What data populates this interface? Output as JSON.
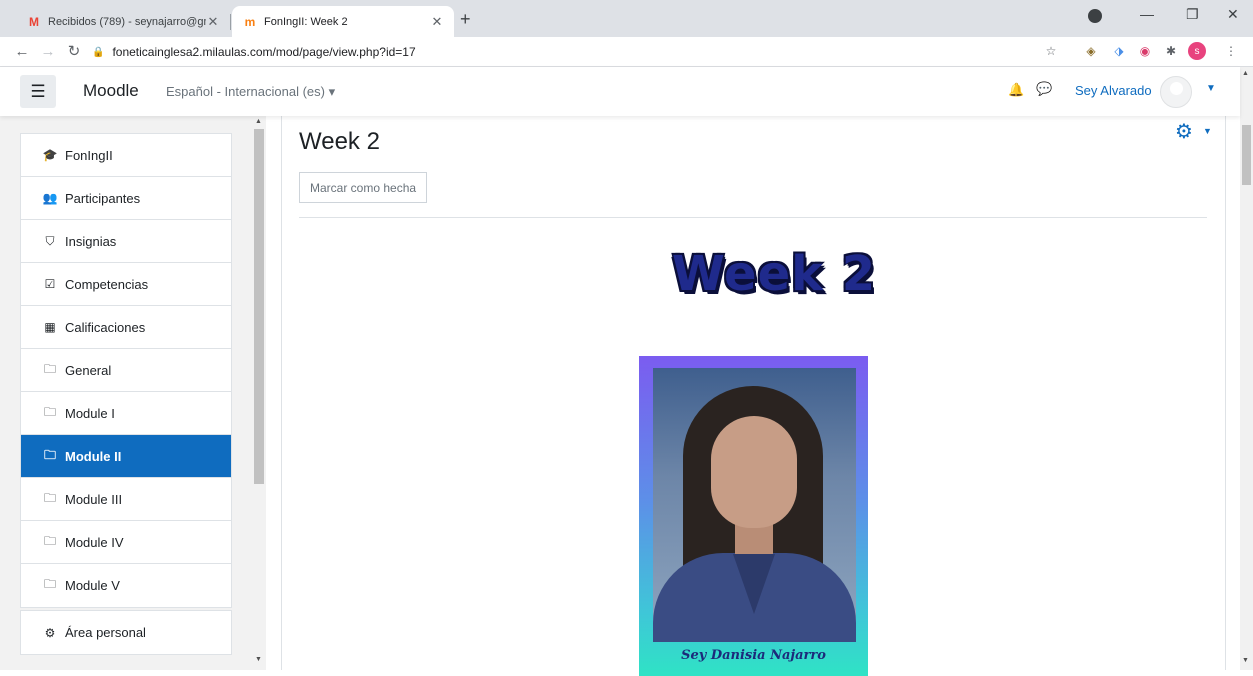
{
  "browser": {
    "tabs": [
      {
        "title": "Recibidos (789) - seynajarro@gm",
        "favicon": "M",
        "favicon_color": "#ea4335"
      },
      {
        "title": "FonIngII: Week 2",
        "favicon": "m",
        "favicon_color": "#f98012"
      }
    ],
    "url": "foneticainglesa2.milaulas.com/mod/page/view.php?id=17",
    "profile_initial": "s"
  },
  "navbar": {
    "brand": "Moodle",
    "language": "Español - Internacional (es)",
    "user_name": "Sey Alvarado"
  },
  "drawer": {
    "main_items": [
      {
        "label": "FonIngII",
        "icon": "graduation-cap-icon",
        "glyph": "🎓"
      },
      {
        "label": "Participantes",
        "icon": "users-icon",
        "glyph": "👥"
      },
      {
        "label": "Insignias",
        "icon": "shield-icon",
        "glyph": "⛉"
      },
      {
        "label": "Competencias",
        "icon": "check-square-icon",
        "glyph": "☑"
      },
      {
        "label": "Calificaciones",
        "icon": "table-icon",
        "glyph": "▦"
      },
      {
        "label": "General",
        "icon": "folder-icon",
        "glyph": "🗀"
      },
      {
        "label": "Module I",
        "icon": "folder-icon",
        "glyph": "🗀"
      },
      {
        "label": "Module II",
        "icon": "folder-icon",
        "glyph": "🗀",
        "active": true
      },
      {
        "label": "Module III",
        "icon": "folder-icon",
        "glyph": "🗀"
      },
      {
        "label": "Module IV",
        "icon": "folder-icon",
        "glyph": "🗀"
      },
      {
        "label": "Module V",
        "icon": "folder-icon",
        "glyph": "🗀"
      }
    ],
    "secondary_items": [
      {
        "label": "Área personal",
        "icon": "tachometer-icon",
        "glyph": "⚙"
      }
    ]
  },
  "content": {
    "page_title": "Week 2",
    "mark_done_label": "Marcar como hecha",
    "heading_image_text": "Week 2",
    "photo_caption": "Sey Danisia Najarro"
  },
  "colors": {
    "accent": "#0f6cbf",
    "heading_fill": "#1f2a8c"
  }
}
